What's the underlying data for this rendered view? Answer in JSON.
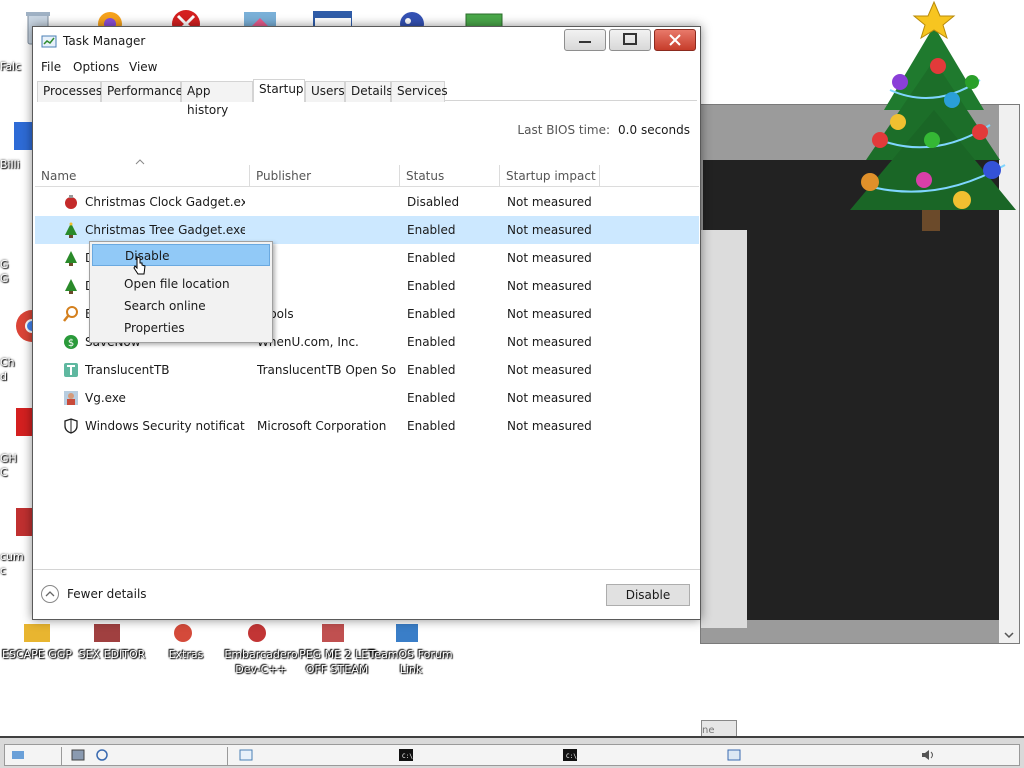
{
  "desktop": {
    "left_labels": [
      "Falc",
      "Billi",
      "G",
      "G",
      "Ch",
      "d",
      "GH",
      "C",
      "cum",
      "c"
    ],
    "icon_labels": [
      "ESCAPE GGP",
      "SEX EDITOR",
      "Extras",
      "Embarcadero Dev-C++",
      "PEG ME 2 LET OFF STEAM",
      "TeamOS Forum Link"
    ],
    "bg_window_button": "ne"
  },
  "window": {
    "title": "Task Manager",
    "minimize_icon": "minimize-icon",
    "maximize_icon": "maximize-icon",
    "close_icon": "close-icon"
  },
  "menu": [
    "File",
    "Options",
    "View"
  ],
  "tabs": [
    {
      "label": "Processes"
    },
    {
      "label": "Performance"
    },
    {
      "label": "App history"
    },
    {
      "label": "Startup",
      "active": true
    },
    {
      "label": "Users"
    },
    {
      "label": "Details"
    },
    {
      "label": "Services"
    }
  ],
  "bios": {
    "label": "Last BIOS time:",
    "value": "0.0 seconds"
  },
  "columns": [
    "Name",
    "Publisher",
    "Status",
    "Startup impact"
  ],
  "rows": [
    {
      "name": "Christmas Clock Gadget.exe",
      "publisher": "",
      "status": "Disabled",
      "impact": "Not measured",
      "icon": "ornament-icon"
    },
    {
      "name": "Christmas Tree Gadget.exe",
      "publisher": "",
      "status": "Enabled",
      "impact": "Not measured",
      "icon": "christmas-tree-icon",
      "selected": true
    },
    {
      "name": "D",
      "publisher": "",
      "status": "Enabled",
      "impact": "Not measured",
      "icon": "christmas-tree-icon"
    },
    {
      "name": "D",
      "publisher": "",
      "status": "Enabled",
      "impact": "Not measured",
      "icon": "christmas-tree-icon"
    },
    {
      "name": "E",
      "publisher": "dtools",
      "status": "Enabled",
      "impact": "Not measured",
      "icon": "magnifier-icon"
    },
    {
      "name": "SaveNow",
      "publisher": "WhenU.com, Inc.",
      "status": "Enabled",
      "impact": "Not measured",
      "icon": "dollar-icon"
    },
    {
      "name": "TranslucentTB",
      "publisher": "TranslucentTB Open Sou...",
      "status": "Enabled",
      "impact": "Not measured",
      "icon": "translucenttb-icon"
    },
    {
      "name": "Vg.exe",
      "publisher": "",
      "status": "Enabled",
      "impact": "Not measured",
      "icon": "person-icon"
    },
    {
      "name": "Windows Security notificati...",
      "publisher": "Microsoft Corporation",
      "status": "Enabled",
      "impact": "Not measured",
      "icon": "shield-icon"
    }
  ],
  "context_menu": [
    {
      "label": "Disable",
      "highlighted": true
    },
    {
      "label": "Open file location"
    },
    {
      "label": "Search online"
    },
    {
      "label": "Properties"
    }
  ],
  "footer": {
    "fewer_details": "Fewer details",
    "disable_button": "Disable"
  },
  "colors": {
    "selection": "#cce8ff",
    "menu_highlight": "#91c9f7",
    "close_button": "#c63c2a"
  }
}
